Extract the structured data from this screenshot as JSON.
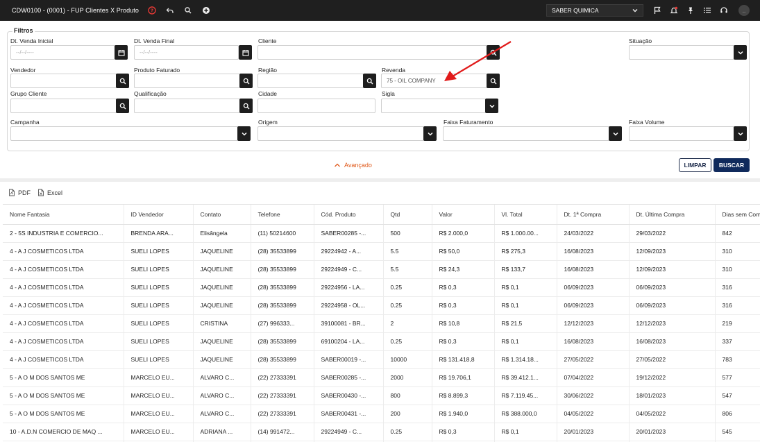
{
  "titlebar": {
    "title": "CDW0100 - (0001) - FUP Clientes X Produto",
    "company": "SABER QUIMICA",
    "more_label": ".."
  },
  "filters": {
    "legend": "Filtros",
    "dt_venda_inicial": {
      "label": "Dt. Venda Inicial",
      "placeholder": "--/--/----"
    },
    "dt_venda_final": {
      "label": "Dt. Venda Final",
      "placeholder": "--/--/----"
    },
    "cliente": {
      "label": "Cliente",
      "value": ""
    },
    "situacao": {
      "label": "Situação",
      "value": ""
    },
    "vendedor": {
      "label": "Vendedor",
      "value": ""
    },
    "produto_faturado": {
      "label": "Produto Faturado",
      "value": ""
    },
    "regiao": {
      "label": "Região",
      "value": ""
    },
    "revenda": {
      "label": "Revenda",
      "value": "75 - OIL COMPANY"
    },
    "grupo_cliente": {
      "label": "Grupo Cliente",
      "value": ""
    },
    "qualificacao": {
      "label": "Qualificação",
      "value": ""
    },
    "cidade": {
      "label": "Cidade",
      "value": ""
    },
    "sigla": {
      "label": "Sigla",
      "value": ""
    },
    "campanha": {
      "label": "Campanha",
      "value": ""
    },
    "origem": {
      "label": "Origem",
      "value": ""
    },
    "faixa_faturamento": {
      "label": "Faixa Faturamento",
      "value": ""
    },
    "faixa_volume": {
      "label": "Faixa Volume",
      "value": ""
    }
  },
  "actions": {
    "advanced": "Avançado",
    "limpar": "LIMPAR",
    "buscar": "BUSCAR",
    "pdf": "PDF",
    "excel": "Excel"
  },
  "table": {
    "columns": [
      "Nome Fantasia",
      "ID Vendedor",
      "Contato",
      "Telefone",
      "Cód. Produto",
      "Qtd",
      "Valor",
      "Vl. Total",
      "Dt. 1ª Compra",
      "Dt. Última Compra",
      "Dias sem Compra"
    ],
    "rows": [
      [
        "2 - 5S INDUSTRIA E COMERCIO...",
        "BRENDA ARA...",
        "Elisângela",
        "(11) 50214600",
        "SABER00285 -...",
        "500",
        "R$ 2.000,0",
        "R$ 1.000.00...",
        "24/03/2022",
        "29/03/2022",
        "842"
      ],
      [
        "4 - A J COSMETICOS LTDA",
        "SUELI LOPES",
        "JAQUELINE",
        "(28) 35533899",
        "29224942 - A...",
        "5.5",
        "R$ 50,0",
        "R$ 275,3",
        "16/08/2023",
        "12/09/2023",
        "310"
      ],
      [
        "4 - A J COSMETICOS LTDA",
        "SUELI LOPES",
        "JAQUELINE",
        "(28) 35533899",
        "29224949 - C...",
        "5.5",
        "R$ 24,3",
        "R$ 133,7",
        "16/08/2023",
        "12/09/2023",
        "310"
      ],
      [
        "4 - A J COSMETICOS LTDA",
        "SUELI LOPES",
        "JAQUELINE",
        "(28) 35533899",
        "29224956 - LA...",
        "0.25",
        "R$ 0,3",
        "R$ 0,1",
        "06/09/2023",
        "06/09/2023",
        "316"
      ],
      [
        "4 - A J COSMETICOS LTDA",
        "SUELI LOPES",
        "JAQUELINE",
        "(28) 35533899",
        "29224958 - OL...",
        "0.25",
        "R$ 0,3",
        "R$ 0,1",
        "06/09/2023",
        "06/09/2023",
        "316"
      ],
      [
        "4 - A J COSMETICOS LTDA",
        "SUELI LOPES",
        "CRISTINA",
        "(27) 996333...",
        "39100081 - BR...",
        "2",
        "R$ 10,8",
        "R$ 21,5",
        "12/12/2023",
        "12/12/2023",
        "219"
      ],
      [
        "4 - A J COSMETICOS LTDA",
        "SUELI LOPES",
        "JAQUELINE",
        "(28) 35533899",
        "69100204 - LA...",
        "0.25",
        "R$ 0,3",
        "R$ 0,1",
        "16/08/2023",
        "16/08/2023",
        "337"
      ],
      [
        "4 - A J COSMETICOS LTDA",
        "SUELI LOPES",
        "JAQUELINE",
        "(28) 35533899",
        "SABER00019 -...",
        "10000",
        "R$ 131.418,8",
        "R$ 1.314.18...",
        "27/05/2022",
        "27/05/2022",
        "783"
      ],
      [
        "5 - A O M DOS SANTOS ME",
        "MARCELO EU...",
        "ALVARO C...",
        "(22) 27333391",
        "SABER00285 -...",
        "2000",
        "R$ 19.706,1",
        "R$ 39.412.1...",
        "07/04/2022",
        "19/12/2022",
        "577"
      ],
      [
        "5 - A O M DOS SANTOS ME",
        "MARCELO EU...",
        "ALVARO C...",
        "(22) 27333391",
        "SABER00430 -...",
        "800",
        "R$ 8.899,3",
        "R$ 7.119.45...",
        "30/06/2022",
        "18/01/2023",
        "547"
      ],
      [
        "5 - A O M DOS SANTOS ME",
        "MARCELO EU...",
        "ALVARO C...",
        "(22) 27333391",
        "SABER00431 -...",
        "200",
        "R$ 1.940,0",
        "R$ 388.000,0",
        "04/05/2022",
        "04/05/2022",
        "806"
      ],
      [
        "10 - A.D.N COMERCIO DE MAQ ...",
        "MARCELO EU...",
        "ADRIANA ...",
        "(14) 991472...",
        "29224949 - C...",
        "0.25",
        "R$ 0,3",
        "R$ 0,1",
        "20/01/2023",
        "20/01/2023",
        "545"
      ],
      [
        "",
        "",
        "",
        "",
        "",
        "",
        "",
        "",
        "",
        "",
        ""
      ]
    ]
  },
  "colors": {
    "accent": "#e05a1c",
    "primary": "#102a5c",
    "titlebar": "#1f1f1f",
    "annotation_arrow": "#e11a1a"
  }
}
